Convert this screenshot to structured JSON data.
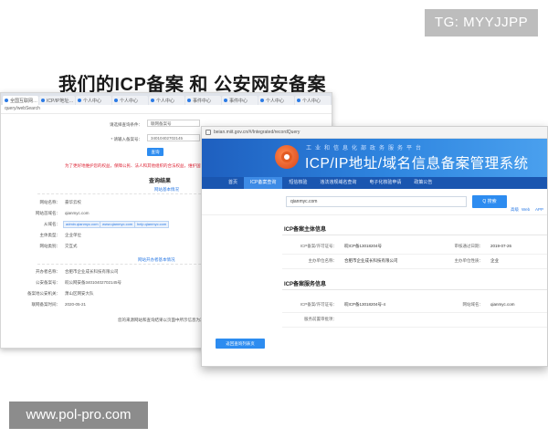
{
  "overlay": {
    "tg_tag": "TG: MYYJJPP",
    "headline": "我们的ICP备案 和 公安网安备案",
    "site_tag": "www.pol-pro.com"
  },
  "back_window": {
    "tabs": [
      {
        "label": "全国互联网…",
        "active": true
      },
      {
        "label": "ICP/IP地址…",
        "active": false
      },
      {
        "label": "个人中心",
        "active": false
      },
      {
        "label": "个人中心",
        "active": false
      },
      {
        "label": "个人中心",
        "active": false
      },
      {
        "label": "事件中心",
        "active": false
      },
      {
        "label": "事件中心",
        "active": false
      },
      {
        "label": "个人中心",
        "active": false
      },
      {
        "label": "个人中心",
        "active": false
      }
    ],
    "address": "query/webSearch",
    "form": {
      "type_label": "请选择查询条件：",
      "type_value": "联网备案号",
      "number_label": "* 请输入备案号：",
      "number_value": "34010402702145",
      "query_button": "查询"
    },
    "notice": "为了更好地维护您的权益，保障公民、法人和其他组织的合法权益，维护国家安全和社会",
    "results_title": "查询结果",
    "basic_info_title": "网站基本情况",
    "fields": [
      {
        "label": "网站名称：",
        "value": "豪华云校"
      },
      {
        "label": "网站首域名：",
        "value": "qianmyc.com"
      },
      {
        "label": "从域名：",
        "value": ""
      },
      {
        "label": "主体类型：",
        "value": "企业单位"
      },
      {
        "label": "网站类别：",
        "value": "交互式"
      }
    ],
    "subdomain_chips": [
      "admin.qianmyc.com",
      "www.qianmyc.com",
      "help.qianmyc.com"
    ],
    "service_info_title": "网站开办者基本情况",
    "service_fields": [
      {
        "label": "开办者名称：",
        "value": "合肥市企业成长科技有限公司"
      },
      {
        "label": "公安备案号：",
        "value": "皖公网安备34010402702145号"
      },
      {
        "label": "备案地公安机关：",
        "value": "萧山区网安大队"
      },
      {
        "label": "联网备案时间：",
        "value": "2020-05-21"
      }
    ],
    "footer_note": "您的来源网站和查询结果以页面中所示信息为准"
  },
  "front_window": {
    "address": "beian.miit.gov.cn/#/Integrated/recordQuery",
    "header_subtitle": "工业和信息化部政务服务平台",
    "header_title": "ICP/IP地址/域名信息备案管理系统",
    "nav": [
      {
        "label": "首页",
        "active": false
      },
      {
        "label": "ICP备案查询",
        "active": true
      },
      {
        "label": "短信核验",
        "active": false
      },
      {
        "label": "违法违规域名查询",
        "active": false
      },
      {
        "label": "电子化核验申请",
        "active": false
      },
      {
        "label": "政策公告",
        "active": false
      }
    ],
    "search": {
      "value": "qianmyc.com",
      "button": "Q 搜索",
      "links": [
        "高级",
        "Web",
        "APP"
      ]
    },
    "subject_section": {
      "title": "ICP备案主体信息",
      "rows": [
        {
          "l1": "ICP备案/许可证号：",
          "v1": "皖ICP备13018204号",
          "l2": "审核通过日期：",
          "v2": "2019-07-26"
        },
        {
          "l1": "主办单位名称：",
          "v1": "合肥市企业成长科技有限公司",
          "l2": "主办单位性质：",
          "v2": "企业"
        }
      ]
    },
    "service_section": {
      "title": "ICP备案服务信息",
      "rows": [
        {
          "l1": "ICP备案/许可证号：",
          "v1": "皖ICP备13018204号-4",
          "l2": "网站域名：",
          "v2": "qianmyc.com"
        },
        {
          "l1": "服务前置审批项：",
          "v1": "",
          "l2": "",
          "v2": ""
        }
      ]
    },
    "bottom_button": "返回查询列表页"
  },
  "colors": {
    "header_blue": "#1e5fbf",
    "nav_blue": "#1a56b0",
    "button_blue": "#2d8cf0",
    "logo_orange": "#e35b22"
  }
}
